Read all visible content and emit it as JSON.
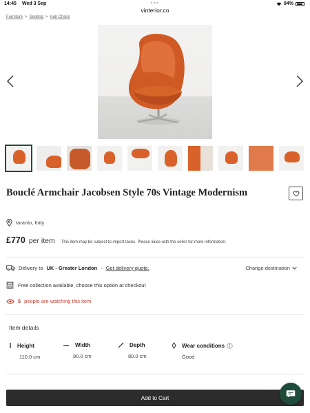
{
  "status_bar": {
    "time": "14:45",
    "date": "Wed 3 Sep",
    "battery": "84%"
  },
  "address_bar": {
    "domain": "vinterior.co"
  },
  "breadcrumb": [
    "Furniture",
    "Seating",
    "Hall Chairs"
  ],
  "product": {
    "title": "Bouclé Armchair Jacobsen Style 70s Vintage Modernism",
    "location": "taranto, Italy",
    "price": "£770",
    "per_item": "per item",
    "tax_note": "This item may be subject to import taxes. Please liaise with the seller for more information."
  },
  "delivery": {
    "prefix": "Delivery to",
    "destination": "UK - Greater London",
    "separator": "-",
    "quote_link": "Get delivery quote.",
    "change_label": "Change destination"
  },
  "collection": {
    "text": "Free collection available, choose this option at checkout"
  },
  "watching": {
    "count": "5",
    "text": "people are watching this item"
  },
  "item_details": {
    "title": "Item details",
    "specs": [
      {
        "label": "Height",
        "value": "110.0 cm",
        "icon": "height-icon"
      },
      {
        "label": "Width",
        "value": "90.0 cm",
        "icon": "width-icon"
      },
      {
        "label": "Depth",
        "value": "80.0 cm",
        "icon": "depth-icon"
      },
      {
        "label": "Wear conditions",
        "value": "Good",
        "icon": "wear-icon"
      }
    ]
  },
  "cart": {
    "label": "Add to Cart"
  },
  "colors": {
    "accent_green": "#1f4b3a",
    "alert_red": "#c23a2b",
    "chair_orange": "#d9622a",
    "cart_bar": "#2c2c2c"
  }
}
